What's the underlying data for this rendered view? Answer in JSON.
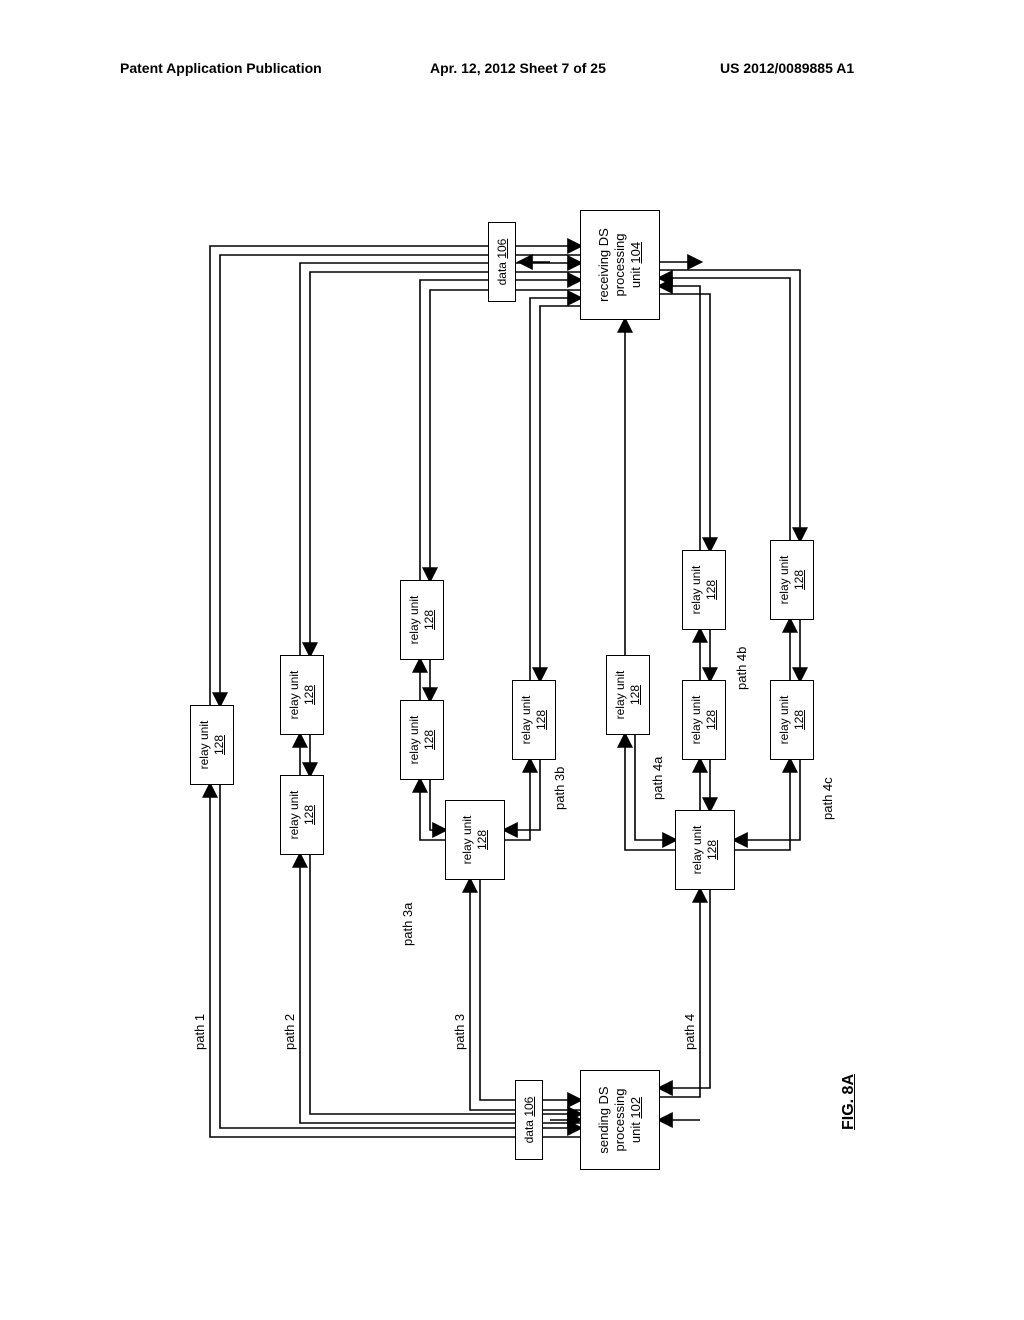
{
  "header": {
    "left": "Patent Application Publication",
    "mid": "Apr. 12, 2012  Sheet 7 of 25",
    "right": "US 2012/0089885 A1"
  },
  "relay": {
    "line1": "relay unit",
    "ref": "128"
  },
  "sending": {
    "line1": "sending DS",
    "line2": "processing",
    "line3": "unit ",
    "ref": "102"
  },
  "receiving": {
    "line1": "receiving DS",
    "line2": "processing",
    "line3": "unit ",
    "ref": "104"
  },
  "data": {
    "label": "data ",
    "ref": "106"
  },
  "paths": {
    "p1": "path 1",
    "p2": "path 2",
    "p3": "path 3",
    "p3a": "path 3a",
    "p3b": "path 3b",
    "p4": "path 4",
    "p4a": "path 4a",
    "p4b": "path 4b",
    "p4c": "path 4c"
  },
  "fig": "FIG. 8A"
}
